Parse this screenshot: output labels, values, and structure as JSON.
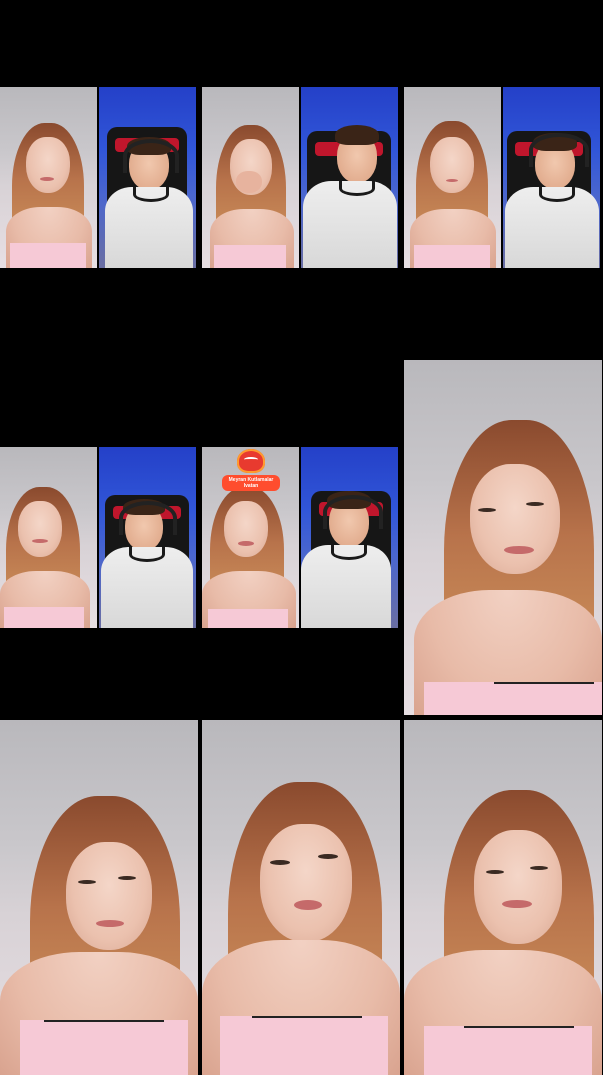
{
  "screen": {
    "background": "#000000"
  },
  "tiles": [
    {
      "id": "r1c1",
      "type": "split",
      "left": "girl",
      "right": "boy"
    },
    {
      "id": "r1c2",
      "type": "split",
      "left": "girl",
      "right": "boy"
    },
    {
      "id": "r1c3",
      "type": "split",
      "left": "girl",
      "right": "boy"
    },
    {
      "id": "r2c1",
      "type": "split",
      "left": "girl",
      "right": "boy"
    },
    {
      "id": "r2c2",
      "type": "split",
      "left": "girl",
      "right": "boy"
    },
    {
      "id": "r2c3",
      "type": "single",
      "subject": "girl"
    },
    {
      "id": "r3c1",
      "type": "single",
      "subject": "girl"
    },
    {
      "id": "r3c2",
      "type": "single",
      "subject": "girl"
    },
    {
      "id": "r3c3",
      "type": "single",
      "subject": "girl"
    }
  ],
  "badge": {
    "icon": "smiling-heart-icon",
    "text": "Meyran Kutlamalar Ivatan",
    "color": "#ff4d2e"
  },
  "colors": {
    "room_wall": "#c9c7cb",
    "blue_wall": "#3156d8",
    "hair": "#b8734b",
    "top": "#f6c9d6",
    "shirt": "#e6e6e6"
  }
}
